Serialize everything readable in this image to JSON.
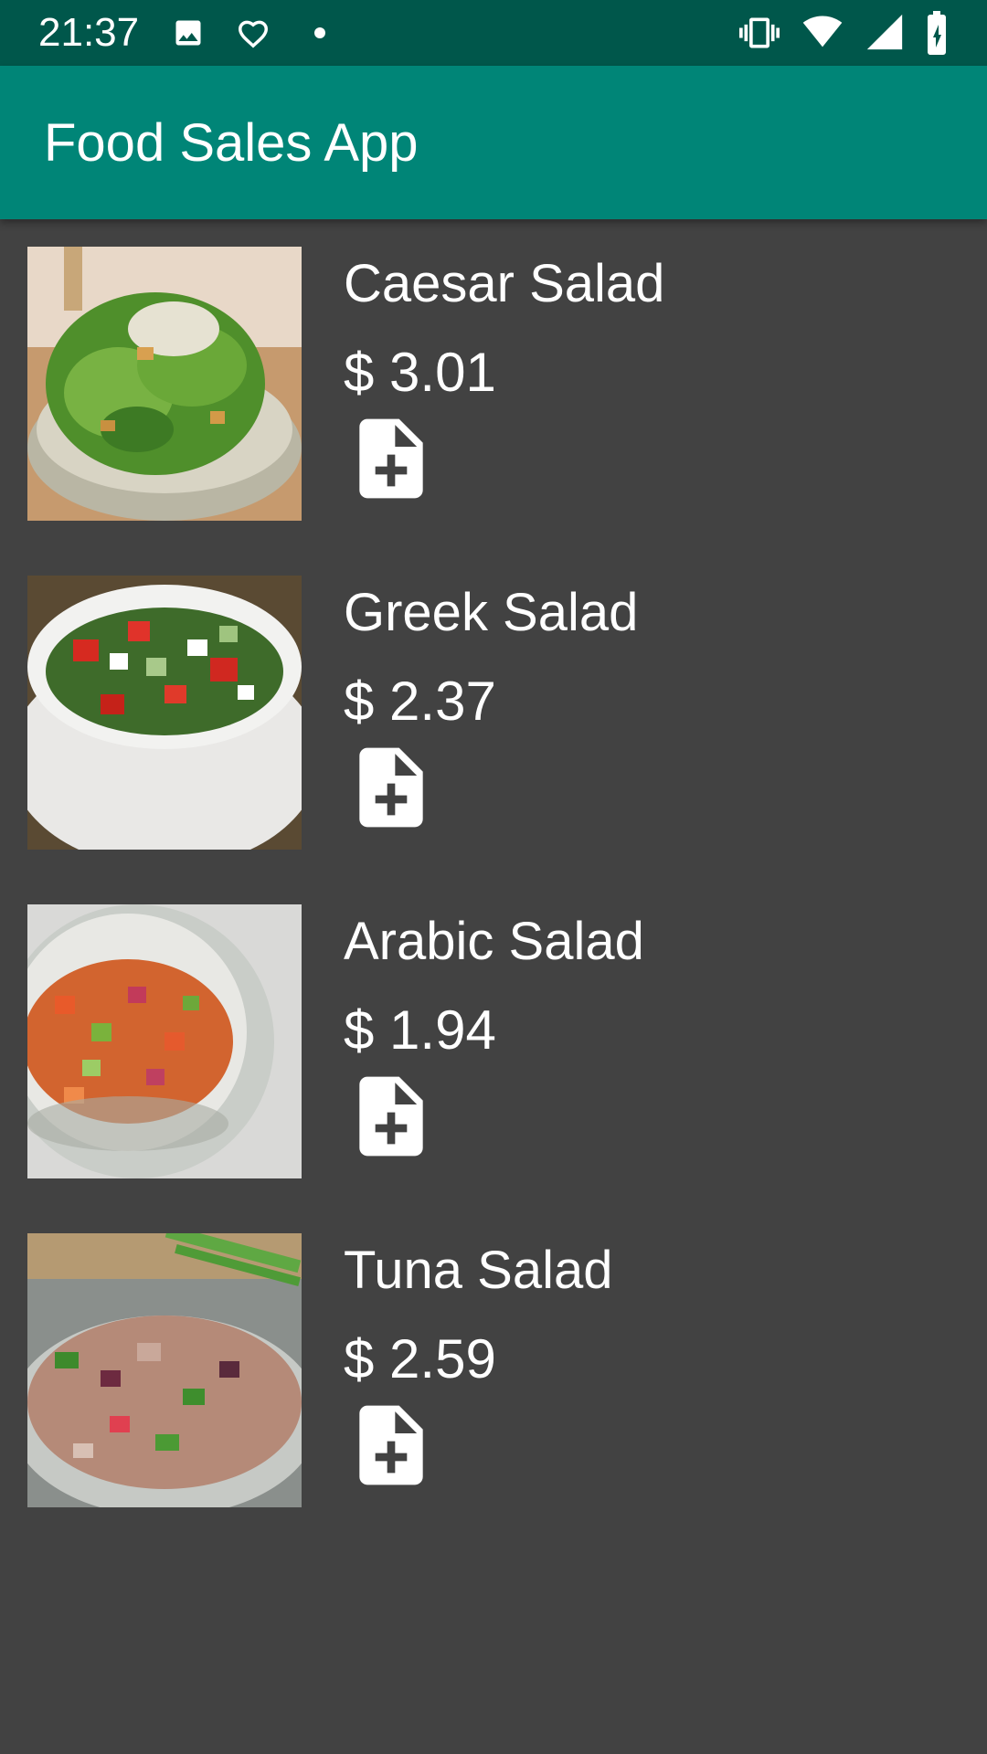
{
  "status_bar": {
    "time": "21:37",
    "icons": [
      "image-icon",
      "heart-icon",
      "dot-icon",
      "vibrate-icon",
      "wifi-icon",
      "signal-icon",
      "battery-charging-icon"
    ]
  },
  "app_bar": {
    "title": "Food Sales App",
    "color": "#008577",
    "status_color": "#00574b"
  },
  "items": [
    {
      "name": "Caesar Salad",
      "price": "$ 3.01",
      "image_icon": "caesar-salad-photo",
      "action_icon": "add-document-icon"
    },
    {
      "name": "Greek Salad",
      "price": "$ 2.37",
      "image_icon": "greek-salad-photo",
      "action_icon": "add-document-icon"
    },
    {
      "name": "Arabic Salad",
      "price": "$ 1.94",
      "image_icon": "arabic-salad-photo",
      "action_icon": "add-document-icon"
    },
    {
      "name": "Tuna Salad",
      "price": "$ 2.59",
      "image_icon": "tuna-salad-photo",
      "action_icon": "add-document-icon"
    }
  ],
  "background_color": "#424242"
}
